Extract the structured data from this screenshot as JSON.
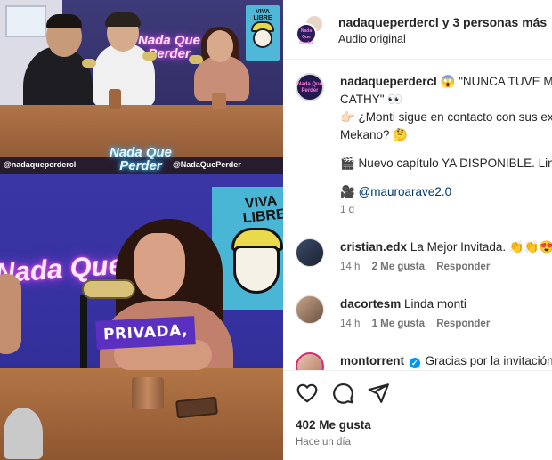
{
  "video": {
    "overlay_handle_left": "@nadaqueperdercl",
    "overlay_handle_right": "@NadaQuePerder",
    "overlay_logo": "Nada Que Perder",
    "neon_sign_small": "Nada Que Perder",
    "neon_sign_big": "Nada Que Perder",
    "poster_text": "VIVA LIBRE",
    "caption_overlay": "PRIVADA,"
  },
  "header": {
    "title": "nadaqueperdercl y 3 personas más",
    "subtitle": "Audio original"
  },
  "post_caption": {
    "username": "nadaqueperdercl",
    "line1": "😱 \"NUNCA TUVE MUCHA",
    "line2": "CATHY\" 👀",
    "line3": "👉🏻 ¿Monti sigue en contacto con sus ex",
    "line4": "Mekano? 🤔",
    "line5": "🎬 Nuevo capítulo YA DISPONIBLE. Link",
    "line6_icon": "🎥",
    "line6_mention": "@mauroarave2.0",
    "time": "1 d",
    "avatar_text": "Nada Que Perder"
  },
  "comments": [
    {
      "username": "cristian.edx",
      "text": "La Mejor Invitada. 👏👏😍",
      "time": "14 h",
      "likes": "2 Me gusta",
      "reply": "Responder"
    },
    {
      "username": "dacortesm",
      "text": "Linda monti",
      "time": "14 h",
      "likes": "1 Me gusta",
      "reply": "Responder"
    },
    {
      "username": "montorrent",
      "text": "Gracias por la invitación!",
      "verified": true
    }
  ],
  "actions": {
    "like_icon": "heart-icon",
    "comment_icon": "comment-icon",
    "share_icon": "share-icon",
    "likes_count": "402 Me gusta",
    "posted_ago": "Hace un día"
  },
  "colors": {
    "text": "#262626",
    "secondary": "#737373",
    "link": "#00376b",
    "verified": "#0095f6",
    "caption_bg": "#5b2fc0"
  }
}
